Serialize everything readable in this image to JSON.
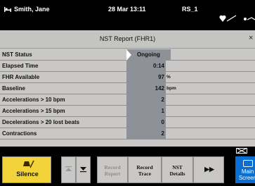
{
  "statusbar": {
    "patient_name": "Smith, Jane",
    "datetime": "28 Mar 13:11",
    "room": "RS_1",
    "icons": [
      "bed-icon",
      "heart-icon",
      "transducer-icon"
    ]
  },
  "panel": {
    "title": "NST Report (FHR1)",
    "close_glyph": "×",
    "rows": [
      {
        "label": "NST Status",
        "value": "Ongoing",
        "unit": ""
      },
      {
        "label": "Elapsed Time",
        "value": "0:14",
        "unit": ""
      },
      {
        "label": "FHR Available",
        "value": "97",
        "unit": "%"
      },
      {
        "label": "Baseline",
        "value": "142",
        "unit": "bpm"
      },
      {
        "label": "Accelerations > 10 bpm",
        "value": "2",
        "unit": ""
      },
      {
        "label": "Accelerations > 15 bpm",
        "value": "1",
        "unit": ""
      },
      {
        "label": "Decelerations > 20 lost beats",
        "value": "0",
        "unit": ""
      },
      {
        "label": "Contractions",
        "value": "2",
        "unit": ""
      }
    ]
  },
  "bottombar": {
    "silence": "Silence",
    "record_report": [
      "Record",
      "Report"
    ],
    "record_trace": [
      "Record",
      "Trace"
    ],
    "nst_details": [
      "NST",
      "Details"
    ],
    "main_screen": "Main Screen",
    "next_glyph": "▶▶"
  },
  "colors": {
    "silence_button": "#f2d33a",
    "main_screen_button": "#0a6fd1",
    "panel_bg": "#c9c8c6",
    "value_cell": "#8e9198"
  }
}
